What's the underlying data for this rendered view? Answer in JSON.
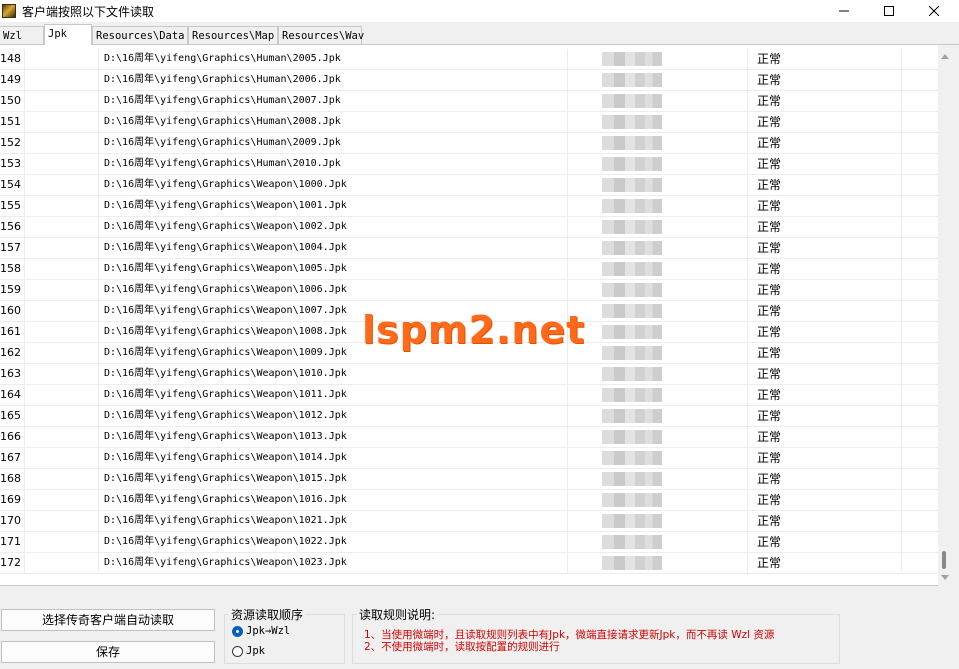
{
  "window": {
    "title": "客户端按照以下文件读取"
  },
  "tabs": [
    {
      "label": "Wzl"
    },
    {
      "label": "Jpk"
    },
    {
      "label": "Resources\\Data"
    },
    {
      "label": "Resources\\Map"
    },
    {
      "label": "Resources\\Wav"
    }
  ],
  "rows": [
    {
      "num": "148",
      "path": "D:\\16周年\\yifeng\\Graphics\\Human\\2005.Jpk",
      "status": "正常"
    },
    {
      "num": "149",
      "path": "D:\\16周年\\yifeng\\Graphics\\Human\\2006.Jpk",
      "status": "正常"
    },
    {
      "num": "150",
      "path": "D:\\16周年\\yifeng\\Graphics\\Human\\2007.Jpk",
      "status": "正常"
    },
    {
      "num": "151",
      "path": "D:\\16周年\\yifeng\\Graphics\\Human\\2008.Jpk",
      "status": "正常"
    },
    {
      "num": "152",
      "path": "D:\\16周年\\yifeng\\Graphics\\Human\\2009.Jpk",
      "status": "正常"
    },
    {
      "num": "153",
      "path": "D:\\16周年\\yifeng\\Graphics\\Human\\2010.Jpk",
      "status": "正常"
    },
    {
      "num": "154",
      "path": "D:\\16周年\\yifeng\\Graphics\\Weapon\\1000.Jpk",
      "status": "正常"
    },
    {
      "num": "155",
      "path": "D:\\16周年\\yifeng\\Graphics\\Weapon\\1001.Jpk",
      "status": "正常"
    },
    {
      "num": "156",
      "path": "D:\\16周年\\yifeng\\Graphics\\Weapon\\1002.Jpk",
      "status": "正常"
    },
    {
      "num": "157",
      "path": "D:\\16周年\\yifeng\\Graphics\\Weapon\\1004.Jpk",
      "status": "正常"
    },
    {
      "num": "158",
      "path": "D:\\16周年\\yifeng\\Graphics\\Weapon\\1005.Jpk",
      "status": "正常"
    },
    {
      "num": "159",
      "path": "D:\\16周年\\yifeng\\Graphics\\Weapon\\1006.Jpk",
      "status": "正常"
    },
    {
      "num": "160",
      "path": "D:\\16周年\\yifeng\\Graphics\\Weapon\\1007.Jpk",
      "status": "正常"
    },
    {
      "num": "161",
      "path": "D:\\16周年\\yifeng\\Graphics\\Weapon\\1008.Jpk",
      "status": "正常"
    },
    {
      "num": "162",
      "path": "D:\\16周年\\yifeng\\Graphics\\Weapon\\1009.Jpk",
      "status": "正常"
    },
    {
      "num": "163",
      "path": "D:\\16周年\\yifeng\\Graphics\\Weapon\\1010.Jpk",
      "status": "正常"
    },
    {
      "num": "164",
      "path": "D:\\16周年\\yifeng\\Graphics\\Weapon\\1011.Jpk",
      "status": "正常"
    },
    {
      "num": "165",
      "path": "D:\\16周年\\yifeng\\Graphics\\Weapon\\1012.Jpk",
      "status": "正常"
    },
    {
      "num": "166",
      "path": "D:\\16周年\\yifeng\\Graphics\\Weapon\\1013.Jpk",
      "status": "正常"
    },
    {
      "num": "167",
      "path": "D:\\16周年\\yifeng\\Graphics\\Weapon\\1014.Jpk",
      "status": "正常"
    },
    {
      "num": "168",
      "path": "D:\\16周年\\yifeng\\Graphics\\Weapon\\1015.Jpk",
      "status": "正常"
    },
    {
      "num": "169",
      "path": "D:\\16周年\\yifeng\\Graphics\\Weapon\\1016.Jpk",
      "status": "正常"
    },
    {
      "num": "170",
      "path": "D:\\16周年\\yifeng\\Graphics\\Weapon\\1021.Jpk",
      "status": "正常"
    },
    {
      "num": "171",
      "path": "D:\\16周年\\yifeng\\Graphics\\Weapon\\1022.Jpk",
      "status": "正常"
    },
    {
      "num": "172",
      "path": "D:\\16周年\\yifeng\\Graphics\\Weapon\\1023.Jpk",
      "status": "正常"
    }
  ],
  "watermark": "lspm2.net",
  "buttons": {
    "auto_read": "选择传奇客户端自动读取",
    "save": "保存"
  },
  "order_group": {
    "title": "资源读取顺序",
    "options": [
      {
        "label": "Jpk→Wzl",
        "selected": true
      },
      {
        "label": "Jpk",
        "selected": false
      }
    ]
  },
  "rules_group": {
    "title": "读取规则说明:",
    "lines": [
      "1、当使用微端时，且读取规则列表中有Jpk，微端直接请求更新Jpk，而不再读 Wzl 资源",
      "2、不使用微端时，读取按配置的规则进行"
    ]
  },
  "colors": {
    "rule_text": "#d40000",
    "watermark": "#ff6a1a",
    "radio_selected": "#0060c0"
  }
}
